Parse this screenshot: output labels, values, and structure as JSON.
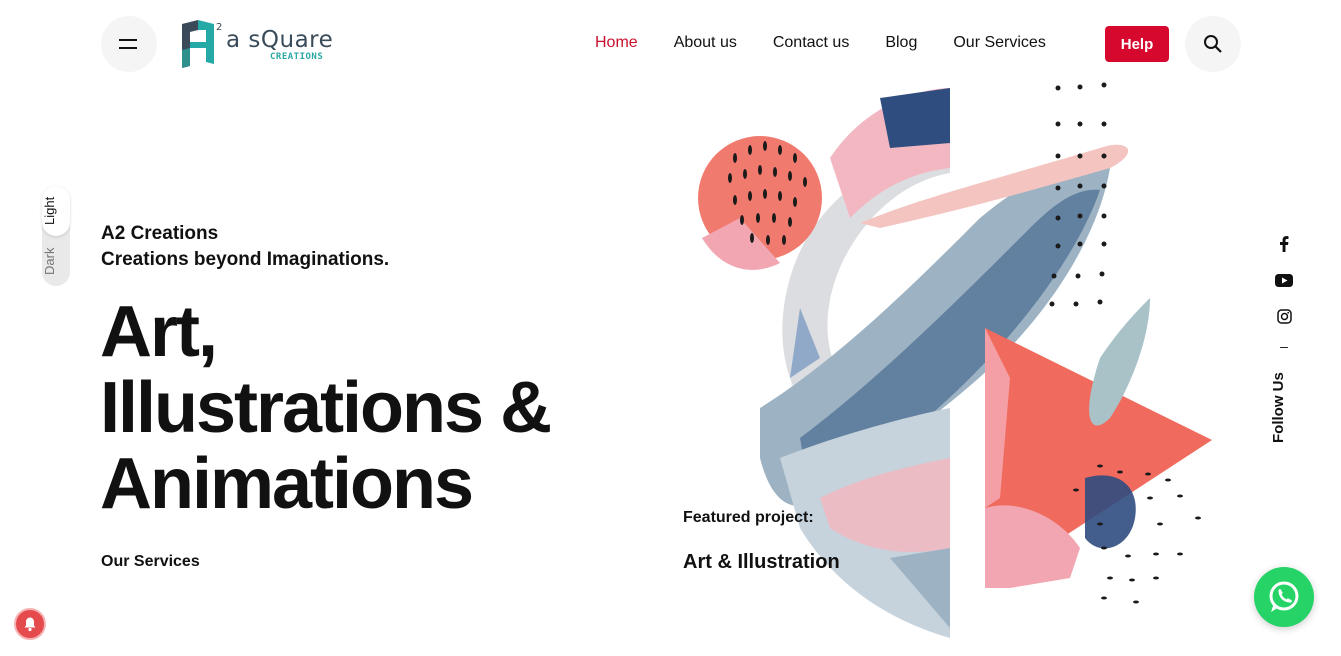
{
  "brand": {
    "logo_alt": "a sQuare",
    "tagline": "CREATIONS",
    "accent": "#c8102e"
  },
  "nav": {
    "items": [
      {
        "label": "Home",
        "active": true
      },
      {
        "label": "About us"
      },
      {
        "label": "Contact us"
      },
      {
        "label": "Blog"
      },
      {
        "label": "Our Services"
      }
    ],
    "help_label": "Help",
    "menu_icon": "hamburger-icon",
    "search_icon": "search-icon"
  },
  "mode_toggle": {
    "light_label": "Light",
    "dark_label": "Dark"
  },
  "hero": {
    "eyebrow_line1": "A2 Creations",
    "eyebrow_line2": "Creations beyond Imaginations.",
    "headline_line1": "Art,",
    "headline_line2": "Illustrations &",
    "headline_line3": "Animations",
    "services_link": "Our Services"
  },
  "featured": {
    "label": "Featured project:",
    "title": "Art & Illustration"
  },
  "social": {
    "icons": [
      "facebook-icon",
      "youtube-icon",
      "instagram-icon"
    ],
    "dash": "–",
    "follow_label": "Follow Us"
  },
  "widgets": {
    "whatsapp_icon": "whatsapp-icon",
    "bell_icon": "bell-icon"
  }
}
